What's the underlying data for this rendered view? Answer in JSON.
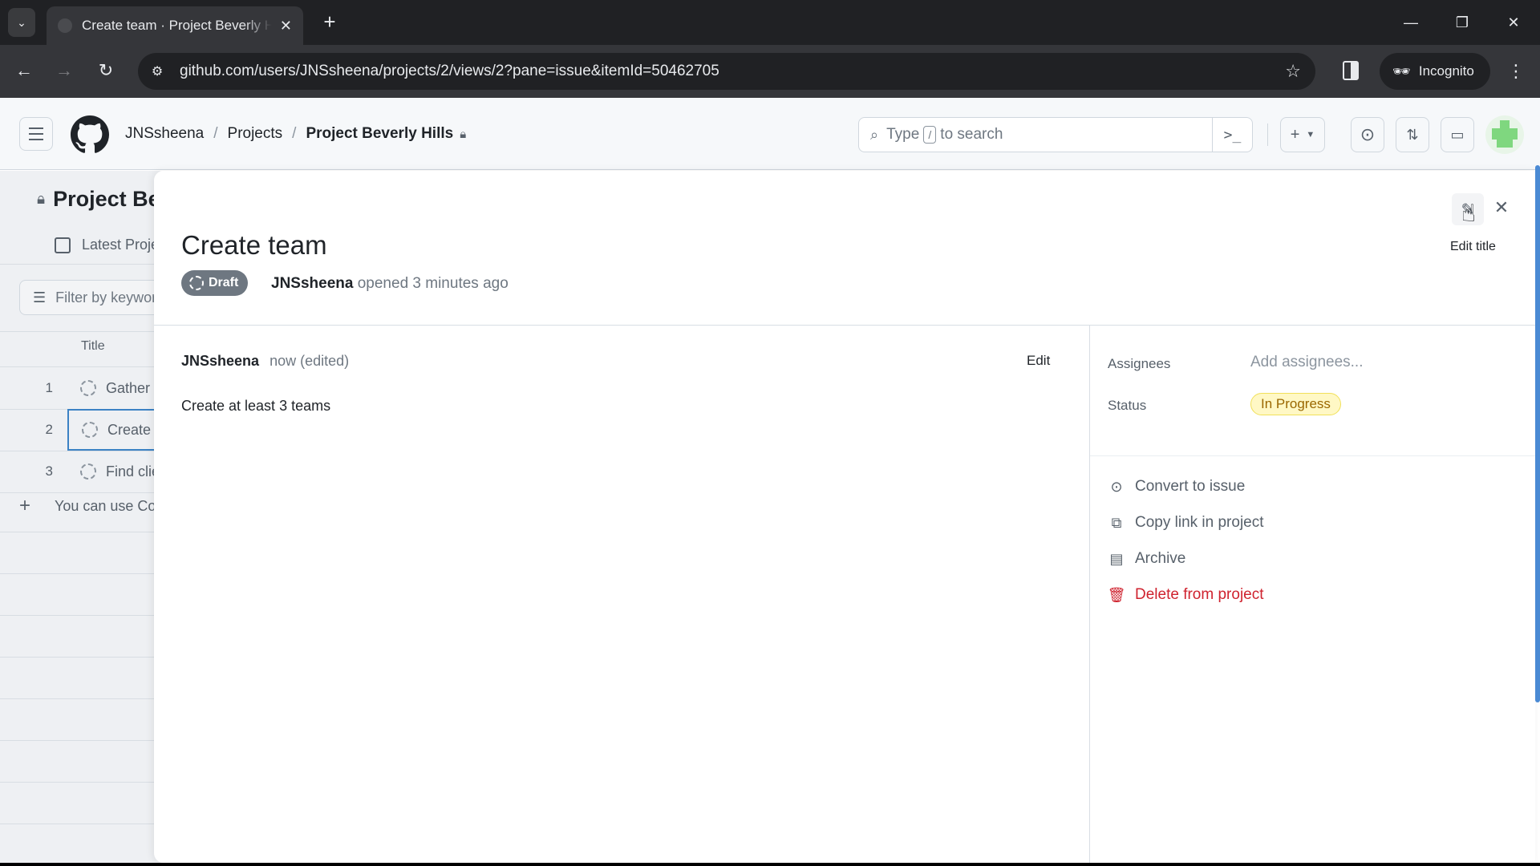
{
  "browser": {
    "tab_title": "Create team · Project Beverly Hills",
    "url": "github.com/users/JNSsheena/projects/2/views/2?pane=issue&itemId=50462705",
    "incognito_label": "Incognito",
    "icons": {
      "tab_search": "chevron-down-icon",
      "close_tab": "close-icon",
      "new_tab": "plus-icon",
      "back": "arrow-left-icon",
      "forward": "arrow-right-icon",
      "reload": "reload-icon",
      "site_info": "tune-icon",
      "bookmark": "star-icon",
      "side_panel": "side-panel-icon",
      "incognito": "incognito-icon",
      "menu": "kebab-icon",
      "minimize": "minimize-icon",
      "restore": "restore-icon",
      "close_window": "close-icon"
    }
  },
  "header": {
    "breadcrumbs": [
      "JNSsheena",
      "Projects",
      "Project Beverly Hills"
    ],
    "search_placeholder_pre": "Type",
    "search_key": "/",
    "search_placeholder_post": "to search"
  },
  "project": {
    "title": "Project Beverly Hills",
    "view_tab": "Latest Project View",
    "filter_placeholder": "Filter by keyword or by field",
    "column_title": "Title",
    "rows": [
      {
        "num": "1",
        "title": "Gather resources"
      },
      {
        "num": "2",
        "title": "Create team"
      },
      {
        "num": "3",
        "title": "Find clients"
      }
    ],
    "add_row_hint": "You can use Control + Space to add an item"
  },
  "item": {
    "title": "Create team",
    "state_badge": "Draft",
    "author": "JNSsheena",
    "opened_text": "opened 3 minutes ago",
    "tooltip": "Edit title",
    "comment": {
      "author": "JNSsheena",
      "meta": "now (edited)",
      "edit_label": "Edit",
      "body": "Create at least 3 teams"
    },
    "fields": {
      "assignees_label": "Assignees",
      "assignees_value": "Add assignees...",
      "status_label": "Status",
      "status_value": "In Progress"
    },
    "actions": [
      {
        "label": "Convert to issue",
        "icon": "issue-opened-icon"
      },
      {
        "label": "Copy link in project",
        "icon": "copy-icon"
      },
      {
        "label": "Archive",
        "icon": "archive-icon"
      },
      {
        "label": "Delete from project",
        "icon": "trash-icon"
      }
    ]
  },
  "colors": {
    "status_in_progress_bg": "#fff8c5",
    "status_in_progress_text": "#9a6700",
    "danger": "#cf222e",
    "draft_badge": "#6e7781",
    "selection": "#3b82c4"
  }
}
